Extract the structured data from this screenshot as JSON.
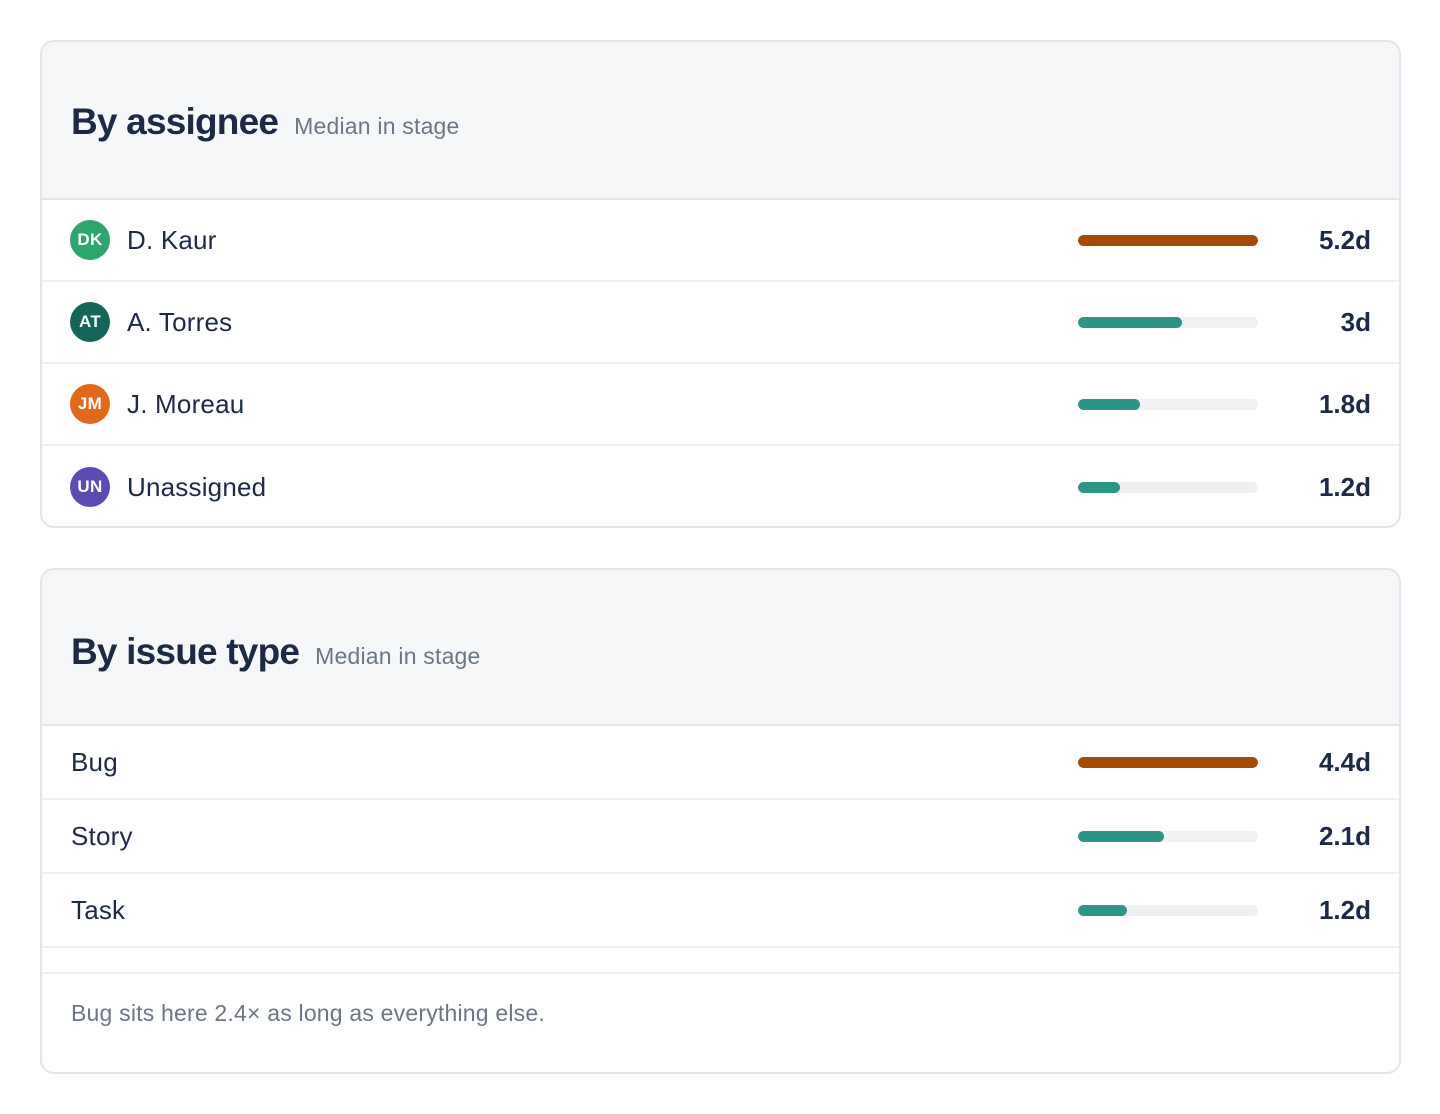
{
  "assignee_card": {
    "title": "By assignee",
    "subtitle": "Median in stage",
    "rows": [
      {
        "initials": "DK",
        "name": "D. Kaur",
        "value": "5.2d",
        "fraction": 1.0,
        "avatar_color": "#2ea56e",
        "bar_color": "#a34a05"
      },
      {
        "initials": "AT",
        "name": "A. Torres",
        "value": "3d",
        "fraction": 0.577,
        "avatar_color": "#14665a",
        "bar_color": "#2e9486"
      },
      {
        "initials": "JM",
        "name": "J. Moreau",
        "value": "1.8d",
        "fraction": 0.346,
        "avatar_color": "#e2691c",
        "bar_color": "#2e9486"
      },
      {
        "initials": "UN",
        "name": "Unassigned",
        "value": "1.2d",
        "fraction": 0.231,
        "avatar_color": "#5b4bb3",
        "bar_color": "#2e9486"
      }
    ]
  },
  "issue_type_card": {
    "title": "By issue type",
    "subtitle": "Median in stage",
    "rows": [
      {
        "name": "Bug",
        "value": "4.4d",
        "fraction": 1.0,
        "bar_color": "#a34a05"
      },
      {
        "name": "Story",
        "value": "2.1d",
        "fraction": 0.477,
        "bar_color": "#2e9486"
      },
      {
        "name": "Task",
        "value": "1.2d",
        "fraction": 0.273,
        "bar_color": "#2e9486"
      }
    ],
    "footnote": "Bug sits here 2.4× as long as everything else."
  },
  "colors": {
    "track": "#eef0f2",
    "text": "#1c2a45",
    "muted": "#6b7686",
    "header_bg": "#f6f7f9",
    "border": "#e3e6ea"
  }
}
